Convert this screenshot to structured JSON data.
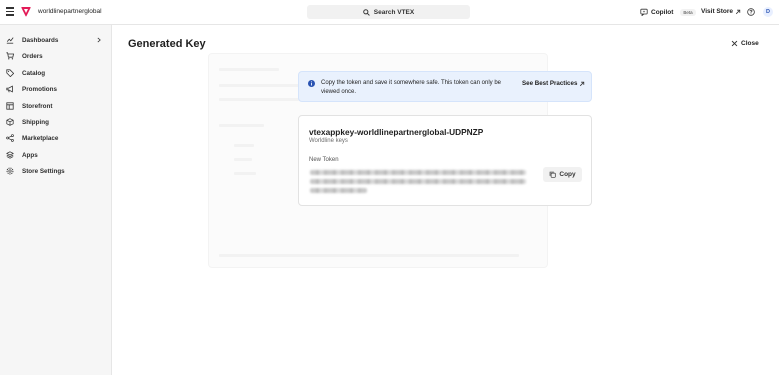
{
  "topbar": {
    "account_name": "worldlinepartnerglobal",
    "search_label": "Search VTEX",
    "copilot_label": "Copilot",
    "beta_label": "Beta",
    "visit_store_label": "Visit Store",
    "avatar_initial": "D"
  },
  "sidebar": {
    "items": [
      {
        "label": "Dashboards",
        "icon": "chart-icon"
      },
      {
        "label": "Orders",
        "icon": "cart-icon"
      },
      {
        "label": "Catalog",
        "icon": "tag-icon"
      },
      {
        "label": "Promotions",
        "icon": "megaphone-icon"
      },
      {
        "label": "Storefront",
        "icon": "layout-icon"
      },
      {
        "label": "Shipping",
        "icon": "box-icon"
      },
      {
        "label": "Marketplace",
        "icon": "share-icon"
      },
      {
        "label": "Apps",
        "icon": "cube-icon"
      },
      {
        "label": "Store Settings",
        "icon": "gear-icon"
      }
    ]
  },
  "main": {
    "title": "Generated Key",
    "close_label": "Close",
    "info": {
      "message": "Copy the token and save it somewhere safe. This token can only be viewed once.",
      "best_practices_label": "See Best Practices"
    },
    "key": {
      "app_key": "vtexappkey-worldlinepartnerglobal-UDPNZP",
      "subtitle": "Worldline keys",
      "token_label": "New Token",
      "copy_label": "Copy"
    }
  },
  "colors": {
    "info_bg": "#e9f1fd",
    "brand_pink": "#e31c58",
    "sidebar_bg": "#f6f6f6"
  }
}
